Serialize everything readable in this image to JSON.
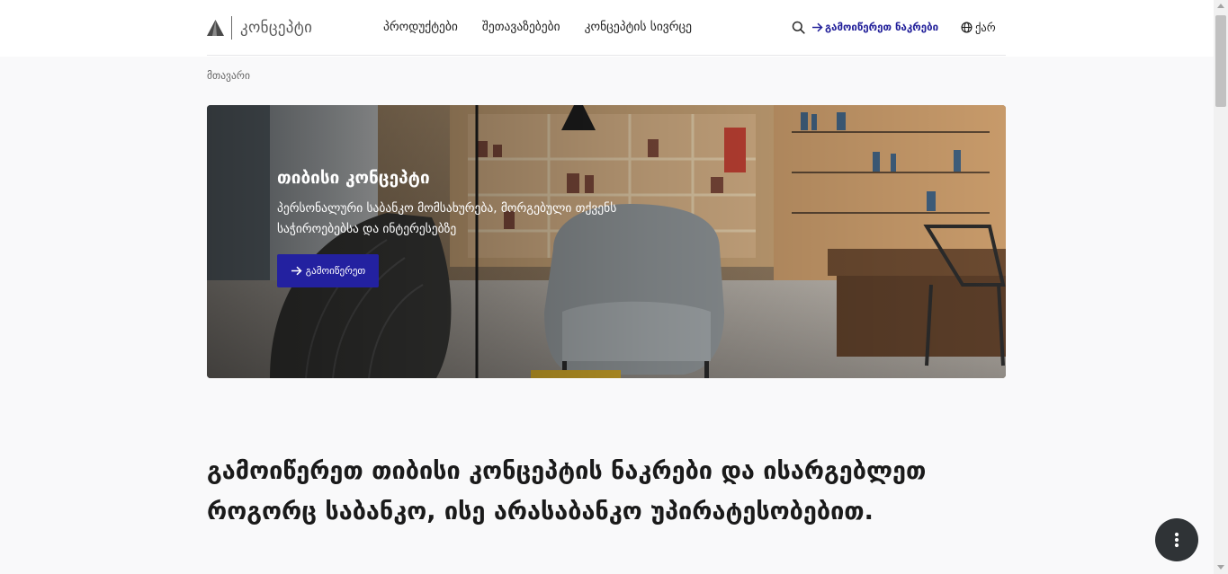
{
  "header": {
    "logo_text": "კონცეპტი",
    "nav": [
      "პროდუქტები",
      "შეთავაზებები",
      "კონცეპტის სივრცე"
    ],
    "search_icon": "search-icon",
    "order_link": "გამოიწერეთ ნაკრები",
    "language": "ქარ"
  },
  "breadcrumb": "მთავარი",
  "hero": {
    "title": "თიბისი კონცეპტი",
    "description": "პერსონალური საბანკო მომსახურება, მორგებული თქვენს საჭიროებებსა და ინტერესებზე",
    "button_label": "გამოიწერეთ"
  },
  "headline": "გამოიწერეთ თიბისი კონცეპტის ნაკრები და ისარგებლეთ როგორც საბანკო, ისე არასაბანკო უპირატესობებით.",
  "fab_icon": "more-vertical-icon",
  "colors": {
    "accent": "#2321a0",
    "order_link": "#22209a",
    "fab": "#2f3336"
  }
}
